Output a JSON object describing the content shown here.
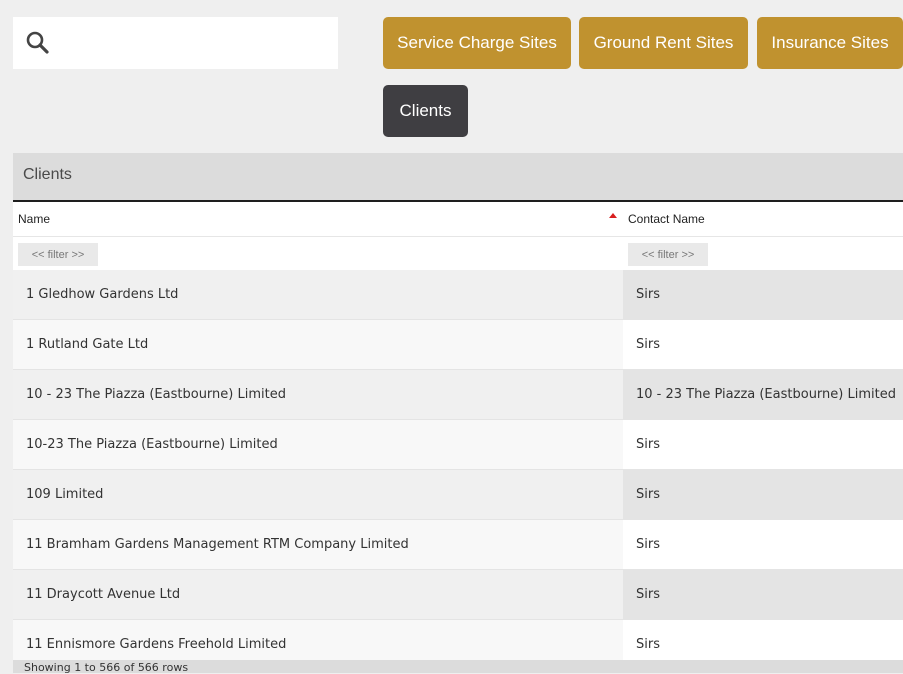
{
  "search": {
    "placeholder": "",
    "value": ""
  },
  "nav": {
    "service_charge": "Service Charge Sites",
    "ground_rent": "Ground Rent Sites",
    "insurance": "Insurance Sites",
    "clients": "Clients"
  },
  "colors": {
    "accent_gold": "#c0922f",
    "active_dark": "#3f3e42",
    "sort_arrow": "#d81f1f"
  },
  "panel": {
    "title": "Clients"
  },
  "table": {
    "columns": [
      {
        "label": "Name",
        "filter": "<< filter >>",
        "sorted": "ascending"
      },
      {
        "label": "Contact Name",
        "filter": "<< filter >>"
      }
    ],
    "rows": [
      {
        "name": "1 Gledhow Gardens Ltd",
        "contact": "Sirs"
      },
      {
        "name": "1 Rutland Gate Ltd",
        "contact": "Sirs"
      },
      {
        "name": "10 - 23 The Piazza (Eastbourne) Limited",
        "contact": "10 - 23 The Piazza (Eastbourne) Limited"
      },
      {
        "name": "10-23 The Piazza (Eastbourne) Limited",
        "contact": "Sirs"
      },
      {
        "name": "109 Limited",
        "contact": "Sirs"
      },
      {
        "name": "11 Bramham Gardens Management RTM Company Limited",
        "contact": "Sirs"
      },
      {
        "name": "11 Draycott Avenue Ltd",
        "contact": "Sirs"
      },
      {
        "name": "11 Ennismore Gardens Freehold Limited",
        "contact": "Sirs"
      }
    ]
  },
  "footer": {
    "status": "Showing 1 to 566 of 566 rows"
  }
}
